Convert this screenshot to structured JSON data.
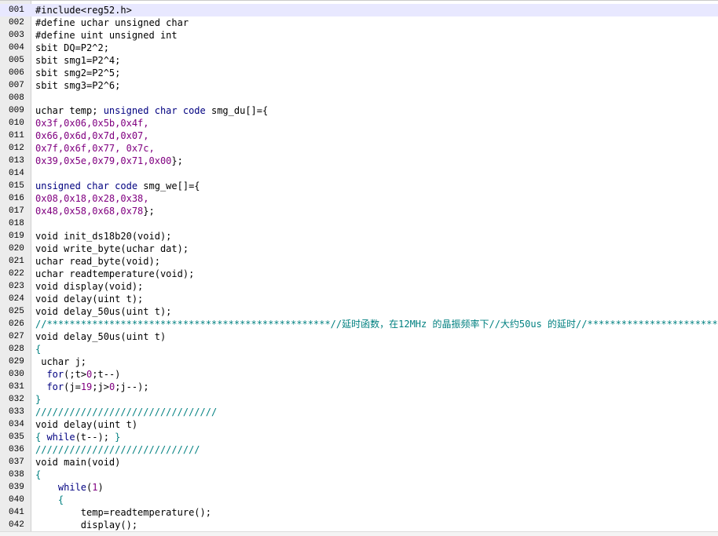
{
  "editor": {
    "current_line": 1,
    "lines": [
      {
        "n": "001",
        "tokens": [
          {
            "t": "#include<reg52.h>",
            "c": "p"
          }
        ]
      },
      {
        "n": "002",
        "tokens": [
          {
            "t": "#define uchar unsigned char",
            "c": "p"
          }
        ]
      },
      {
        "n": "003",
        "tokens": [
          {
            "t": "#define uint unsigned int",
            "c": "p"
          }
        ]
      },
      {
        "n": "004",
        "tokens": [
          {
            "t": "sbit DQ=P2^2;",
            "c": "p"
          }
        ]
      },
      {
        "n": "005",
        "tokens": [
          {
            "t": "sbit smg1=P2^4;",
            "c": "p"
          }
        ]
      },
      {
        "n": "006",
        "tokens": [
          {
            "t": "sbit smg2=P2^5;",
            "c": "p"
          }
        ]
      },
      {
        "n": "007",
        "tokens": [
          {
            "t": "sbit smg3=P2^6;",
            "c": "p"
          }
        ]
      },
      {
        "n": "008",
        "tokens": []
      },
      {
        "n": "009",
        "tokens": [
          {
            "t": "uchar temp; ",
            "c": "p"
          },
          {
            "t": "unsigned char code",
            "c": "k"
          },
          {
            "t": " smg_du[]={",
            "c": "p"
          }
        ]
      },
      {
        "n": "010",
        "tokens": [
          {
            "t": "0x3f,0x06,0x5b,0x4f,",
            "c": "n"
          }
        ]
      },
      {
        "n": "011",
        "tokens": [
          {
            "t": "0x66,0x6d,0x7d,0x07,",
            "c": "n"
          }
        ]
      },
      {
        "n": "012",
        "tokens": [
          {
            "t": "0x7f,0x6f,0x77, 0x7c,",
            "c": "n"
          }
        ]
      },
      {
        "n": "013",
        "tokens": [
          {
            "t": "0x39,0x5e,0x79,0x71,0x00",
            "c": "n"
          },
          {
            "t": "};",
            "c": "p"
          }
        ]
      },
      {
        "n": "014",
        "tokens": []
      },
      {
        "n": "015",
        "tokens": [
          {
            "t": "unsigned char code",
            "c": "k"
          },
          {
            "t": " smg_we[]={",
            "c": "p"
          }
        ]
      },
      {
        "n": "016",
        "tokens": [
          {
            "t": "0x08,0x18,0x28,0x38,",
            "c": "n"
          }
        ]
      },
      {
        "n": "017",
        "tokens": [
          {
            "t": "0x48,0x58,0x68,0x78",
            "c": "n"
          },
          {
            "t": "};",
            "c": "p"
          }
        ]
      },
      {
        "n": "018",
        "tokens": []
      },
      {
        "n": "019",
        "tokens": [
          {
            "t": "void init_ds18b20(void);",
            "c": "p"
          }
        ]
      },
      {
        "n": "020",
        "tokens": [
          {
            "t": "void write_byte(uchar dat);",
            "c": "p"
          }
        ]
      },
      {
        "n": "021",
        "tokens": [
          {
            "t": "uchar read_byte(void);",
            "c": "p"
          }
        ]
      },
      {
        "n": "022",
        "tokens": [
          {
            "t": "uchar readtemperature(void);",
            "c": "p"
          }
        ]
      },
      {
        "n": "023",
        "tokens": [
          {
            "t": "void display(void);",
            "c": "p"
          }
        ]
      },
      {
        "n": "024",
        "tokens": [
          {
            "t": "void delay(uint t);",
            "c": "p"
          }
        ]
      },
      {
        "n": "025",
        "tokens": [
          {
            "t": "void delay_50us(uint t);",
            "c": "p"
          }
        ]
      },
      {
        "n": "026",
        "tokens": [
          {
            "t": "//**************************************************//延时函数，在12MHz 的晶振频率下//大约50us 的延时//*************************",
            "c": "c"
          }
        ]
      },
      {
        "n": "027",
        "tokens": [
          {
            "t": "void delay_50us(uint t)",
            "c": "p"
          }
        ]
      },
      {
        "n": "028",
        "tokens": [
          {
            "t": "{",
            "c": "c"
          }
        ]
      },
      {
        "n": "029",
        "tokens": [
          {
            "t": " uchar j;",
            "c": "p"
          }
        ]
      },
      {
        "n": "030",
        "tokens": [
          {
            "t": "  ",
            "c": "p"
          },
          {
            "t": "for",
            "c": "k"
          },
          {
            "t": "(;t>",
            "c": "p"
          },
          {
            "t": "0",
            "c": "n"
          },
          {
            "t": ";t--)",
            "c": "p"
          }
        ]
      },
      {
        "n": "031",
        "tokens": [
          {
            "t": "  ",
            "c": "p"
          },
          {
            "t": "for",
            "c": "k"
          },
          {
            "t": "(j=",
            "c": "p"
          },
          {
            "t": "19",
            "c": "n"
          },
          {
            "t": ";j>",
            "c": "p"
          },
          {
            "t": "0",
            "c": "n"
          },
          {
            "t": ";j--);",
            "c": "p"
          }
        ]
      },
      {
        "n": "032",
        "tokens": [
          {
            "t": "}",
            "c": "c"
          }
        ]
      },
      {
        "n": "033",
        "tokens": [
          {
            "t": "////////////////////////////////",
            "c": "c"
          }
        ]
      },
      {
        "n": "034",
        "tokens": [
          {
            "t": "void delay(uint t)",
            "c": "p"
          }
        ]
      },
      {
        "n": "035",
        "tokens": [
          {
            "t": "{ ",
            "c": "c"
          },
          {
            "t": "while",
            "c": "k"
          },
          {
            "t": "(t--); ",
            "c": "p"
          },
          {
            "t": "}",
            "c": "c"
          }
        ]
      },
      {
        "n": "036",
        "tokens": [
          {
            "t": "/////////////////////////////",
            "c": "c"
          }
        ]
      },
      {
        "n": "037",
        "tokens": [
          {
            "t": "void main(void)",
            "c": "p"
          }
        ]
      },
      {
        "n": "038",
        "tokens": [
          {
            "t": "{",
            "c": "c"
          }
        ]
      },
      {
        "n": "039",
        "tokens": [
          {
            "t": "    ",
            "c": "p"
          },
          {
            "t": "while",
            "c": "k"
          },
          {
            "t": "(",
            "c": "p"
          },
          {
            "t": "1",
            "c": "n"
          },
          {
            "t": ")",
            "c": "p"
          }
        ]
      },
      {
        "n": "040",
        "tokens": [
          {
            "t": "    {",
            "c": "c"
          }
        ]
      },
      {
        "n": "041",
        "tokens": [
          {
            "t": "        temp=readtemperature();",
            "c": "p"
          }
        ]
      },
      {
        "n": "042",
        "tokens": [
          {
            "t": "        display();",
            "c": "p"
          }
        ]
      }
    ]
  }
}
